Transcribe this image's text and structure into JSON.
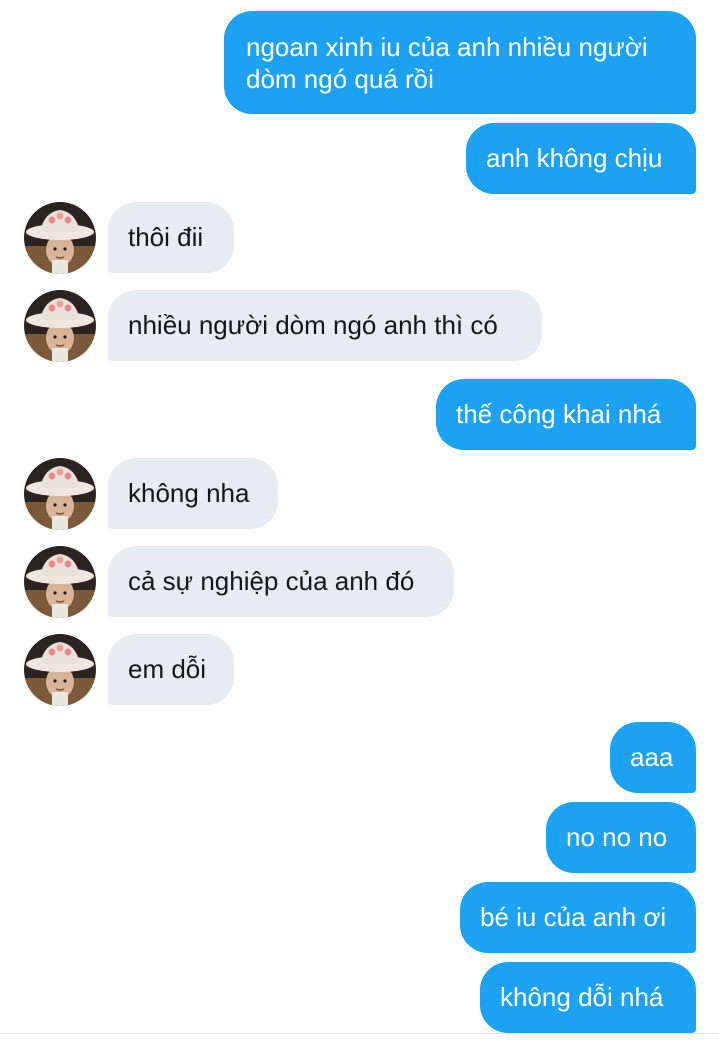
{
  "colors": {
    "outgoing_bubble": "#1da1f2",
    "incoming_bubble": "#e6ecf0",
    "outgoing_text": "#ffffff",
    "incoming_text": "#14171a"
  },
  "avatar_icon": "user-avatar-icon",
  "messages": [
    {
      "direction": "out",
      "text": "ngoan xinh iu của anh nhiều người dòm ngó quá rồi"
    },
    {
      "direction": "out",
      "text": "anh không chịu"
    },
    {
      "direction": "in",
      "text": "thôi đii"
    },
    {
      "direction": "in",
      "text": "nhiều người dòm ngó anh thì có"
    },
    {
      "direction": "out",
      "text": "thế công khai nhá"
    },
    {
      "direction": "in",
      "text": "không nha"
    },
    {
      "direction": "in",
      "text": "cả sự nghiệp của anh đó"
    },
    {
      "direction": "in",
      "text": "em dỗi"
    },
    {
      "direction": "out",
      "text": "aaa"
    },
    {
      "direction": "out",
      "text": "no no no"
    },
    {
      "direction": "out",
      "text": "bé iu của anh ơi"
    },
    {
      "direction": "out",
      "text": "không dỗi nhá"
    }
  ]
}
